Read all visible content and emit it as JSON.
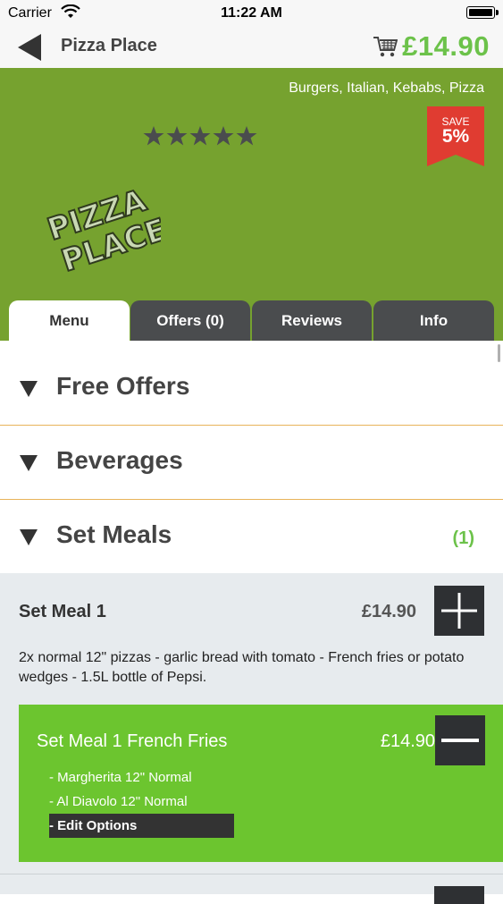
{
  "status_bar": {
    "carrier": "Carrier",
    "time": "11:22 AM"
  },
  "nav": {
    "title": "Pizza Place",
    "cart_total": "£14.90"
  },
  "restaurant": {
    "cuisines": "Burgers, Italian, Kebabs, Pizza",
    "save_label": "SAVE",
    "save_percent": "5%",
    "rating": 5,
    "rating_max": 5,
    "logo_text": "PIZZA PLACE"
  },
  "tabs": [
    {
      "label": "Menu",
      "active": true
    },
    {
      "label": "Offers (0)",
      "active": false
    },
    {
      "label": "Reviews",
      "active": false
    },
    {
      "label": "Info",
      "active": false
    }
  ],
  "sections": [
    {
      "title": "Free Offers",
      "count": ""
    },
    {
      "title": "Beverages",
      "count": ""
    },
    {
      "title": "Set Meals",
      "count": "(1)"
    }
  ],
  "meal": {
    "name": "Set Meal 1",
    "price": "£14.90",
    "description": "2x normal 12\" pizzas - garlic bread with tomato - French fries or potato wedges - 1.5L bottle of Pepsi.",
    "selected": {
      "title": "Set Meal 1 French Fries",
      "price": "£14.90",
      "options": [
        "- Margherita 12\" Normal",
        "- Al Diavolo 12\" Normal"
      ],
      "edit_label": "- Edit Options"
    }
  },
  "colors": {
    "accent_green": "#6cc24a",
    "hero_green": "#76a22f",
    "badge_red": "#e03c31",
    "tab_dark": "#4a4c4e",
    "section_divider": "#e8b35a"
  }
}
